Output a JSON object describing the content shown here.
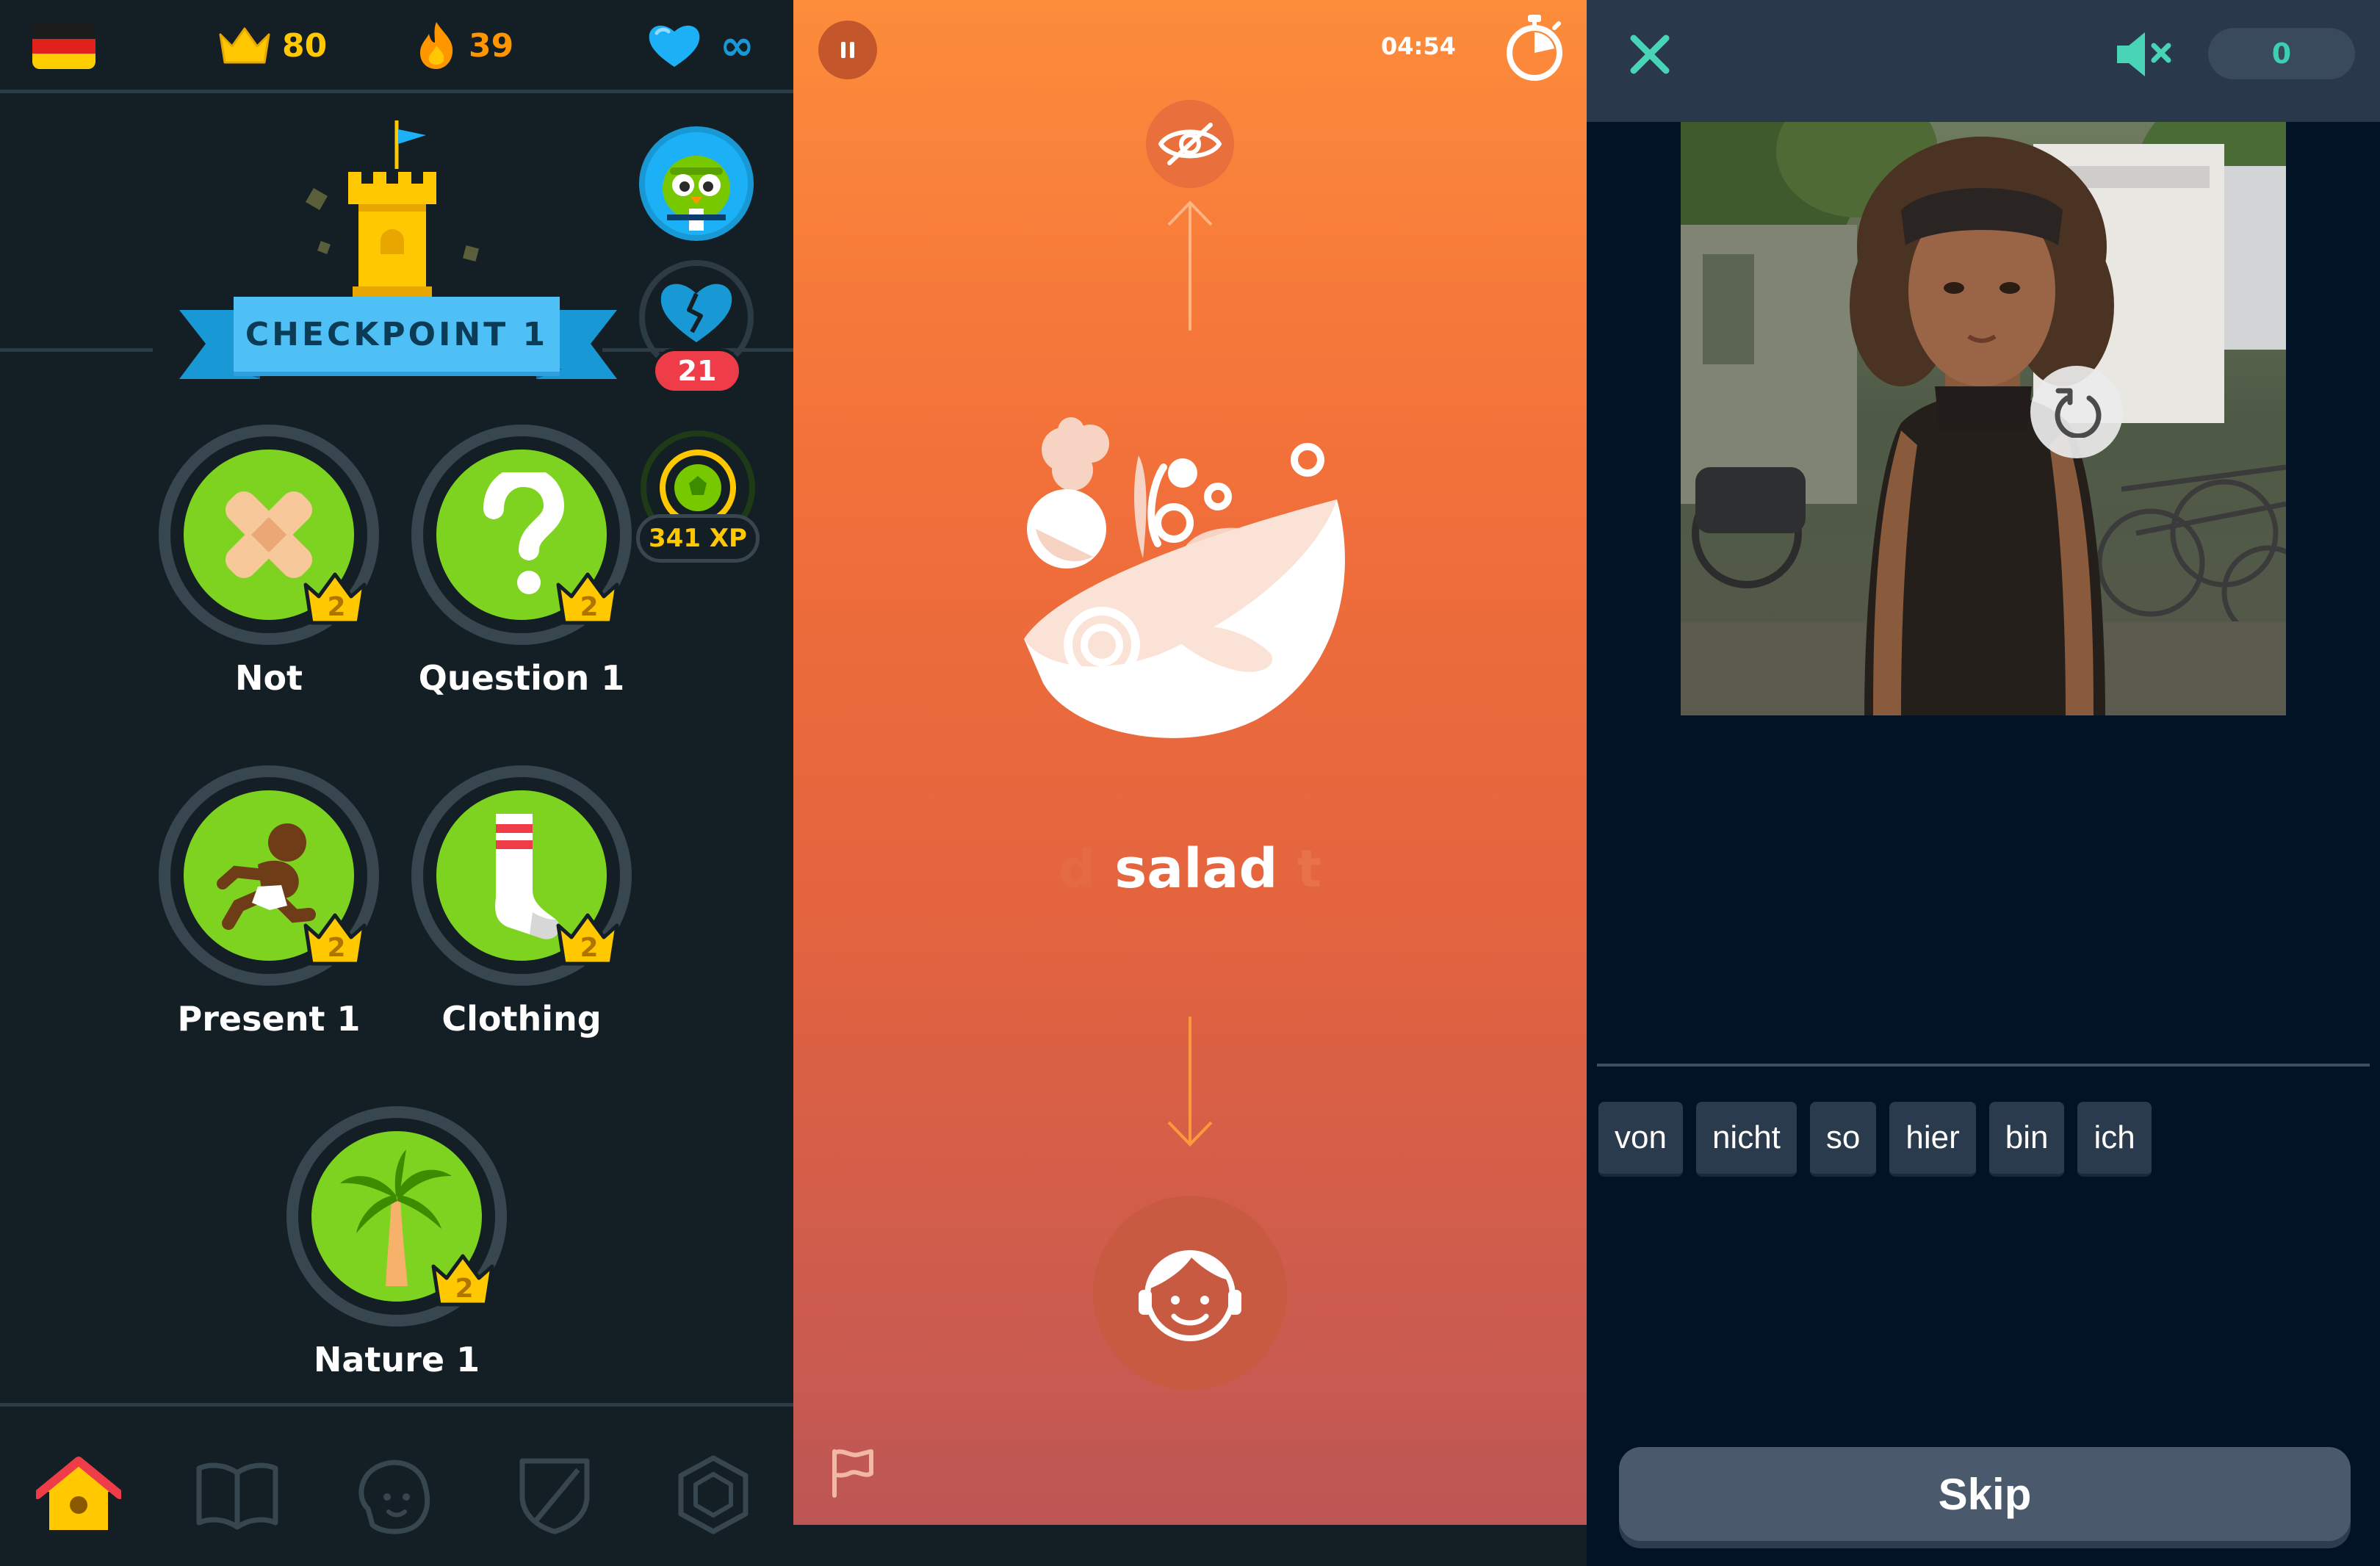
{
  "colors": {
    "panel1_bg": "#131f24",
    "lesson_green": "#7ed321",
    "crown_gold": "#ffc800",
    "ribbon_blue": "#4fc0f5",
    "panel2_orange_top": "#fd8c3b",
    "panel2_red_bottom": "#b95555",
    "panel3_bg": "#011324",
    "score_teal": "#3cd0b0"
  },
  "panel1": {
    "stats": {
      "flag_icon": "germany-flag-icon",
      "crowns": "80",
      "streak": "39",
      "hearts": "∞"
    },
    "checkpoint": {
      "label": "CHECKPOINT 1"
    },
    "side": {
      "broken_hearts_count": "21",
      "xp_label": "341 XP"
    },
    "lessons": [
      {
        "label": "Not",
        "level": "2",
        "icon": "bandage-cross-icon"
      },
      {
        "label": "Question 1",
        "level": "2",
        "icon": "question-mark-icon"
      },
      {
        "label": "Present 1",
        "level": "2",
        "icon": "running-person-icon"
      },
      {
        "label": "Clothing",
        "level": "2",
        "icon": "sock-icon"
      },
      {
        "label": "Nature 1",
        "level": "2",
        "icon": "palm-tree-icon"
      }
    ],
    "nav": [
      "home-icon",
      "book-icon",
      "profile-icon",
      "shield-icon",
      "shop-icon"
    ]
  },
  "panel2": {
    "timer": "04:54",
    "word_faded_left": "d",
    "word": "salad",
    "word_faded_right": "t"
  },
  "panel3": {
    "score": "0",
    "word_bank": [
      "von",
      "nicht",
      "so",
      "hier",
      "bin",
      "ich"
    ],
    "skip_label": "Skip"
  }
}
